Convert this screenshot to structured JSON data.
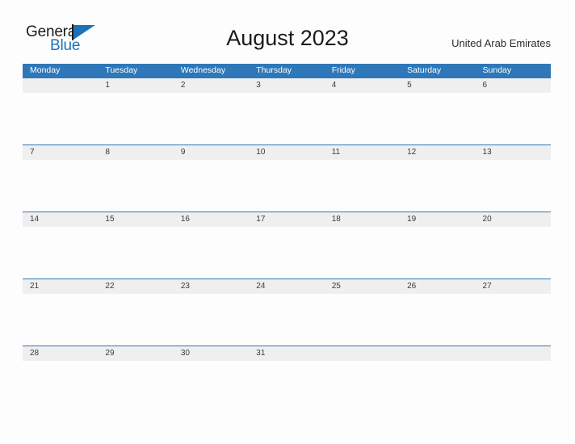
{
  "brand": {
    "name_part1": "General",
    "name_part2": "Blue",
    "flag_icon": "blue-flag-triangle-icon",
    "color_primary": "#1c72b8",
    "color_text": "#1b1b1b"
  },
  "header": {
    "title": "August 2023",
    "country": "United Arab Emirates"
  },
  "theme": {
    "header_blue": "#2e77b8",
    "date_strip_gray": "#efefef",
    "page_background": "#fdfdfd",
    "date_text": "#3a3a3a"
  },
  "calendar": {
    "month": "August",
    "year": "2023",
    "week_start": "Monday",
    "weekdays": [
      "Monday",
      "Tuesday",
      "Wednesday",
      "Thursday",
      "Friday",
      "Saturday",
      "Sunday"
    ],
    "weeks": [
      [
        "",
        "1",
        "2",
        "3",
        "4",
        "5",
        "6"
      ],
      [
        "7",
        "8",
        "9",
        "10",
        "11",
        "12",
        "13"
      ],
      [
        "14",
        "15",
        "16",
        "17",
        "18",
        "19",
        "20"
      ],
      [
        "21",
        "22",
        "23",
        "24",
        "25",
        "26",
        "27"
      ],
      [
        "28",
        "29",
        "30",
        "31",
        "",
        "",
        ""
      ]
    ],
    "events": []
  }
}
